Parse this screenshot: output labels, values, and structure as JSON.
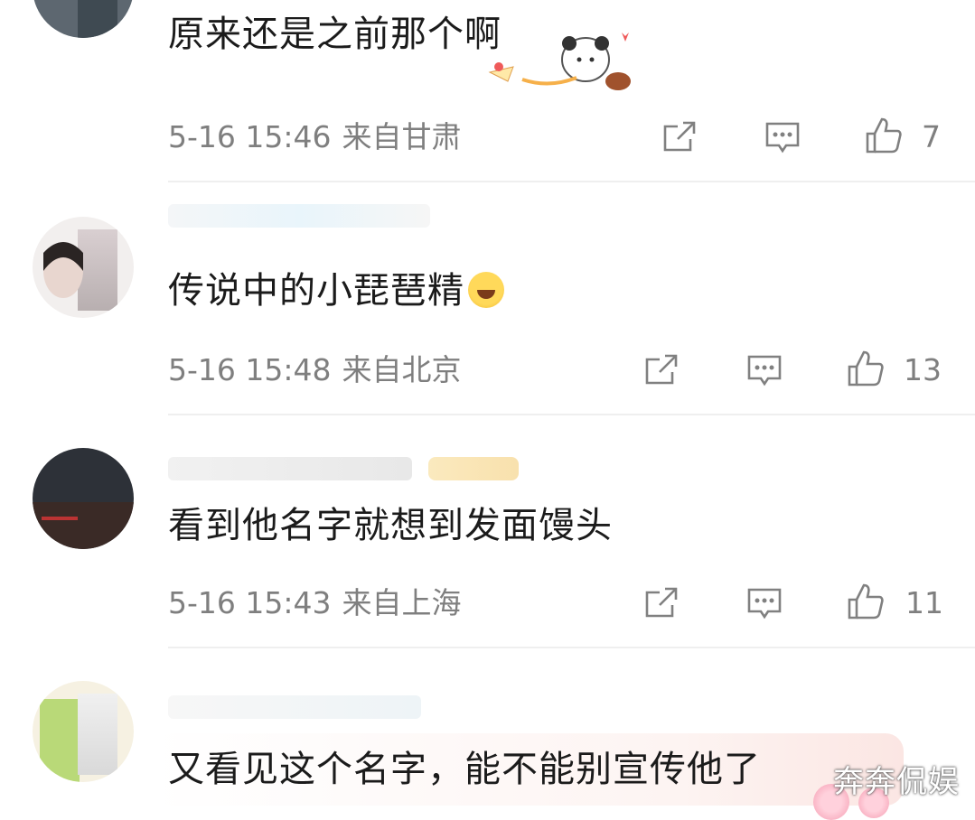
{
  "comments": [
    {
      "text": "原来还是之前那个啊",
      "time": "5-16 15:46",
      "location": "来自甘肃",
      "likes": "7"
    },
    {
      "text": "传说中的小琵琶精",
      "time": "5-16 15:48",
      "location": "来自北京",
      "likes": "13"
    },
    {
      "text": "看到他名字就想到发面馒头",
      "time": "5-16 15:43",
      "location": "来自上海",
      "likes": "11"
    },
    {
      "text": "又看见这个名字，能不能别宣传他了"
    }
  ],
  "icons": {
    "share": "share-icon",
    "comment": "comment-icon",
    "like": "like-icon",
    "emoji": "laughing-crying-emoji-icon"
  },
  "watermark": "奔奔侃娱",
  "colors": {
    "text": "#1b1b1b",
    "meta": "#7f7f7f",
    "divider": "#efefef"
  }
}
